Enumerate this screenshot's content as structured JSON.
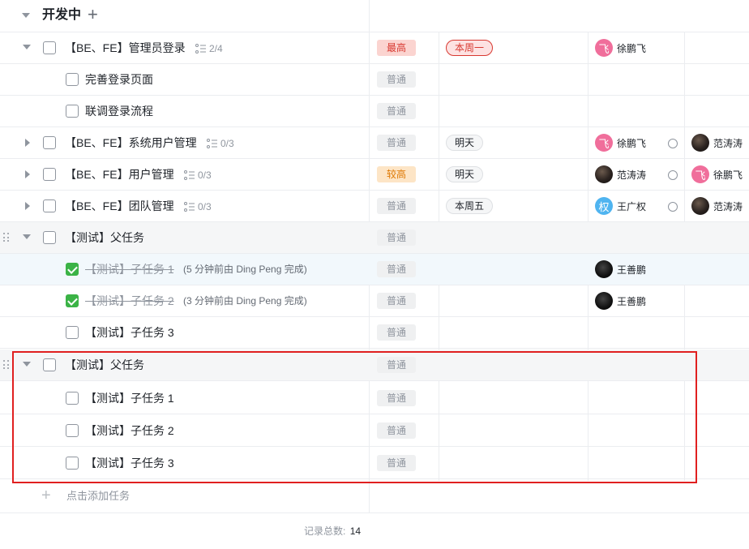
{
  "group": {
    "title": "开发中",
    "add_symbol": "+"
  },
  "tasks": [
    {
      "title": "【BE、FE】管理员登录",
      "subtasks": "2/4",
      "priority": "最高",
      "due": "本周一",
      "assignees": [
        "徐鹏飞"
      ]
    },
    {
      "title": "完善登录页面",
      "priority": "普通"
    },
    {
      "title": "联调登录流程",
      "priority": "普通"
    },
    {
      "title": "【BE、FE】系统用户管理",
      "subtasks": "0/3",
      "priority": "普通",
      "due": "明天",
      "assignees": [
        "徐鹏飞",
        "范涛涛"
      ]
    },
    {
      "title": "【BE、FE】用户管理",
      "subtasks": "0/3",
      "priority": "较高",
      "due": "明天",
      "assignees": [
        "范涛涛",
        "徐鹏飞"
      ]
    },
    {
      "title": "【BE、FE】团队管理",
      "subtasks": "0/3",
      "priority": "普通",
      "due": "本周五",
      "assignees": [
        "王广权",
        "范涛涛"
      ]
    },
    {
      "title": "【测试】父任务",
      "priority": "普通"
    },
    {
      "title": "【测试】子任务 1",
      "note": "(5 分钟前由 Ding Peng 完成)",
      "priority": "普通",
      "assignees": [
        "王善鹏"
      ]
    },
    {
      "title": "【测试】子任务 2",
      "note": "(3 分钟前由 Ding Peng 完成)",
      "priority": "普通",
      "assignees": [
        "王善鹏"
      ]
    },
    {
      "title": "【测试】子任务 3",
      "priority": "普通"
    },
    {
      "title": "【测试】父任务",
      "priority": "普通"
    },
    {
      "title": "【测试】子任务 1",
      "priority": "普通"
    },
    {
      "title": "【测试】子任务 2",
      "priority": "普通"
    },
    {
      "title": "【测试】子任务 3",
      "priority": "普通"
    }
  ],
  "avatar_glyphs": {
    "pink": "飞",
    "blue": "权"
  },
  "add_task": "点击添加任务",
  "footer": {
    "label": "记录总数:",
    "count": "14"
  },
  "colors": {
    "priority_high": "#d83931",
    "priority_mid": "#de7802",
    "check_done": "#3bb346",
    "highlight_box": "#e02020"
  }
}
